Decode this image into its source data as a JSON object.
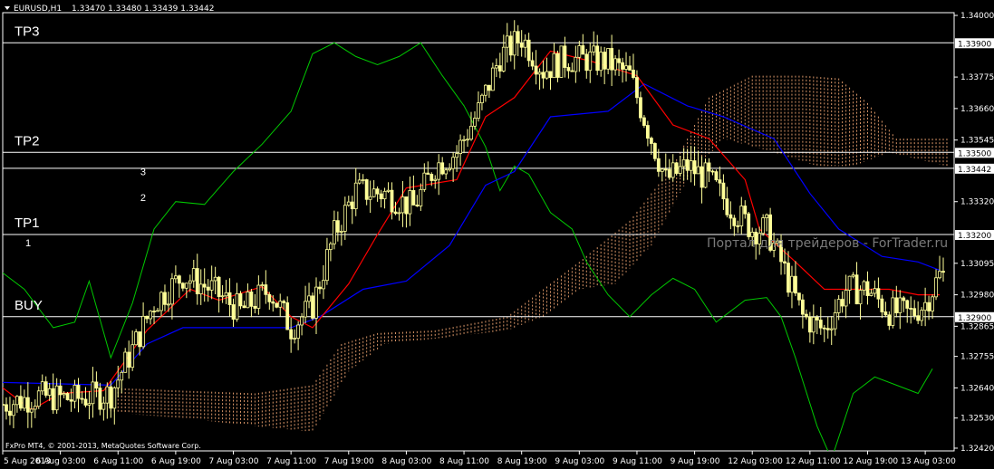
{
  "window": {
    "symbol": "EURUSD,H1",
    "quote": "1.33470 1.33480 1.33439 1.33442",
    "watermark": "Портал для трейдеров - ForTrader.ru",
    "copyright": "FxPro MT4, © 2001-2013, MetaQuotes Software Corp."
  },
  "colors": {
    "background": "#000000",
    "candle": "#ffff99",
    "tenkan": "#ff0000",
    "kijun": "#0000ff",
    "chikou": "#00c800",
    "cloud": "#ffb07a",
    "level_line": "#ffffff"
  },
  "levels": [
    {
      "label": "TP3",
      "price": 1.339,
      "tag": "1.33900"
    },
    {
      "label": "TP2",
      "price": 1.335,
      "tag": "1.33500"
    },
    {
      "label": "",
      "price": 1.33442,
      "tag": "1.33442"
    },
    {
      "label": "TP1",
      "price": 1.332,
      "tag": "1.33200"
    },
    {
      "label": "BUY",
      "price": 1.329,
      "tag": "1.32900"
    }
  ],
  "wave_marks": [
    {
      "text": "3",
      "time": 6.5,
      "price": 1.3343
    },
    {
      "text": "2",
      "time": 6.5,
      "price": 1.33335
    },
    {
      "text": "1",
      "time": 1.0,
      "price": 1.3317
    }
  ],
  "chart_data": {
    "type": "candlestick",
    "title": "EURUSD,H1",
    "ylim": [
      1.3241,
      1.3401
    ],
    "y_ticks": [
      "1.34000",
      "1.33775",
      "1.33660",
      "1.33545",
      "1.33320",
      "1.33095",
      "1.32980",
      "1.32865",
      "1.32755",
      "1.32640",
      "1.32530",
      "1.32420"
    ],
    "x_ticks": [
      {
        "label": "5 Aug 2013",
        "bar": 0
      },
      {
        "label": "6 Aug 03:00",
        "bar": 16
      },
      {
        "label": "6 Aug 11:00",
        "bar": 32
      },
      {
        "label": "6 Aug 19:00",
        "bar": 48
      },
      {
        "label": "7 Aug 03:00",
        "bar": 64
      },
      {
        "label": "7 Aug 11:00",
        "bar": 80
      },
      {
        "label": "7 Aug 19:00",
        "bar": 96
      },
      {
        "label": "8 Aug 03:00",
        "bar": 112
      },
      {
        "label": "8 Aug 11:00",
        "bar": 128
      },
      {
        "label": "8 Aug 19:00",
        "bar": 144
      },
      {
        "label": "9 Aug 03:00",
        "bar": 160
      },
      {
        "label": "9 Aug 11:00",
        "bar": 176
      },
      {
        "label": "9 Aug 19:00",
        "bar": 192
      },
      {
        "label": "12 Aug 03:00",
        "bar": 208
      },
      {
        "label": "12 Aug 11:00",
        "bar": 224
      },
      {
        "label": "12 Aug 19:00",
        "bar": 240
      },
      {
        "label": "13 Aug 03:00",
        "bar": 256
      }
    ],
    "close_path": [
      [
        0,
        1.3258
      ],
      [
        10,
        1.3261
      ],
      [
        20,
        1.326
      ],
      [
        30,
        1.3262
      ],
      [
        36,
        1.3278
      ],
      [
        42,
        1.3295
      ],
      [
        50,
        1.3305
      ],
      [
        58,
        1.33
      ],
      [
        66,
        1.3292
      ],
      [
        74,
        1.33
      ],
      [
        80,
        1.3286
      ],
      [
        86,
        1.3294
      ],
      [
        92,
        1.332
      ],
      [
        98,
        1.3336
      ],
      [
        106,
        1.3335
      ],
      [
        114,
        1.333
      ],
      [
        120,
        1.3345
      ],
      [
        126,
        1.335
      ],
      [
        132,
        1.3365
      ],
      [
        138,
        1.3385
      ],
      [
        144,
        1.3392
      ],
      [
        150,
        1.338
      ],
      [
        156,
        1.3384
      ],
      [
        162,
        1.3384
      ],
      [
        168,
        1.3383
      ],
      [
        174,
        1.3378
      ],
      [
        180,
        1.3355
      ],
      [
        184,
        1.334
      ],
      [
        190,
        1.3345
      ],
      [
        196,
        1.334
      ],
      [
        202,
        1.333
      ],
      [
        208,
        1.3322
      ],
      [
        212,
        1.3322
      ],
      [
        216,
        1.331
      ],
      [
        222,
        1.329
      ],
      [
        228,
        1.3285
      ],
      [
        234,
        1.33
      ],
      [
        240,
        1.33
      ],
      [
        246,
        1.3292
      ],
      [
        252,
        1.3291
      ],
      [
        256,
        1.3295
      ],
      [
        260,
        1.3305
      ]
    ],
    "tenkan_path": [
      [
        0,
        1.3264
      ],
      [
        8,
        1.3256
      ],
      [
        16,
        1.3262
      ],
      [
        28,
        1.3263
      ],
      [
        40,
        1.3285
      ],
      [
        52,
        1.33
      ],
      [
        60,
        1.3296
      ],
      [
        72,
        1.3301
      ],
      [
        80,
        1.329
      ],
      [
        86,
        1.3286
      ],
      [
        96,
        1.3302
      ],
      [
        104,
        1.332
      ],
      [
        112,
        1.3337
      ],
      [
        126,
        1.334
      ],
      [
        134,
        1.3363
      ],
      [
        142,
        1.337
      ],
      [
        152,
        1.3387
      ],
      [
        164,
        1.3383
      ],
      [
        176,
        1.3378
      ],
      [
        186,
        1.336
      ],
      [
        196,
        1.3355
      ],
      [
        206,
        1.334
      ],
      [
        210,
        1.3322
      ],
      [
        220,
        1.331
      ],
      [
        228,
        1.33
      ],
      [
        236,
        1.33
      ],
      [
        246,
        1.33
      ],
      [
        254,
        1.3298
      ],
      [
        260,
        1.3298
      ]
    ],
    "kijun_path": [
      [
        0,
        1.3266
      ],
      [
        30,
        1.3265
      ],
      [
        40,
        1.328
      ],
      [
        50,
        1.3286
      ],
      [
        80,
        1.3286
      ],
      [
        88,
        1.329
      ],
      [
        100,
        1.33
      ],
      [
        112,
        1.3303
      ],
      [
        124,
        1.3316
      ],
      [
        134,
        1.3338
      ],
      [
        142,
        1.3343
      ],
      [
        152,
        1.3363
      ],
      [
        168,
        1.3365
      ],
      [
        178,
        1.3375
      ],
      [
        190,
        1.3367
      ],
      [
        200,
        1.3363
      ],
      [
        214,
        1.3355
      ],
      [
        224,
        1.3335
      ],
      [
        232,
        1.3322
      ],
      [
        244,
        1.3312
      ],
      [
        254,
        1.331
      ],
      [
        260,
        1.3307
      ]
    ],
    "chikou_path": [
      [
        0,
        1.3306
      ],
      [
        6,
        1.33
      ],
      [
        14,
        1.3286
      ],
      [
        20,
        1.3288
      ],
      [
        24,
        1.3303
      ],
      [
        30,
        1.3275
      ],
      [
        36,
        1.3295
      ],
      [
        42,
        1.3322
      ],
      [
        48,
        1.3332
      ],
      [
        56,
        1.3331
      ],
      [
        64,
        1.3343
      ],
      [
        72,
        1.3353
      ],
      [
        80,
        1.3365
      ],
      [
        86,
        1.3386
      ],
      [
        92,
        1.339
      ],
      [
        98,
        1.3385
      ],
      [
        104,
        1.3382
      ],
      [
        110,
        1.3385
      ],
      [
        116,
        1.339
      ],
      [
        122,
        1.3378
      ],
      [
        128,
        1.3367
      ],
      [
        134,
        1.3352
      ],
      [
        138,
        1.3336
      ],
      [
        142,
        1.3345
      ],
      [
        146,
        1.3342
      ],
      [
        152,
        1.3328
      ],
      [
        158,
        1.3322
      ],
      [
        162,
        1.331
      ],
      [
        168,
        1.3298
      ],
      [
        174,
        1.329
      ],
      [
        180,
        1.3298
      ],
      [
        186,
        1.3304
      ],
      [
        192,
        1.33
      ],
      [
        198,
        1.3288
      ],
      [
        206,
        1.3296
      ],
      [
        212,
        1.3297
      ],
      [
        216,
        1.329
      ],
      [
        220,
        1.3275
      ],
      [
        226,
        1.325
      ],
      [
        230,
        1.3238
      ],
      [
        236,
        1.3262
      ],
      [
        242,
        1.3268
      ],
      [
        248,
        1.3265
      ],
      [
        254,
        1.3262
      ],
      [
        258,
        1.3271
      ]
    ],
    "cloud_top_path": [
      [
        30,
        1.3264
      ],
      [
        50,
        1.3263
      ],
      [
        70,
        1.3262
      ],
      [
        86,
        1.3265
      ],
      [
        94,
        1.328
      ],
      [
        104,
        1.3284
      ],
      [
        120,
        1.3285
      ],
      [
        140,
        1.329
      ],
      [
        160,
        1.331
      ],
      [
        174,
        1.3325
      ],
      [
        186,
        1.3345
      ],
      [
        196,
        1.337
      ],
      [
        208,
        1.3378
      ],
      [
        222,
        1.3378
      ],
      [
        232,
        1.3377
      ],
      [
        240,
        1.3368
      ],
      [
        248,
        1.3355
      ],
      [
        262,
        1.3355
      ]
    ],
    "cloud_bottom_path": [
      [
        30,
        1.3255
      ],
      [
        50,
        1.3253
      ],
      [
        70,
        1.325
      ],
      [
        86,
        1.3248
      ],
      [
        96,
        1.327
      ],
      [
        106,
        1.328
      ],
      [
        120,
        1.3282
      ],
      [
        140,
        1.3285
      ],
      [
        150,
        1.329
      ],
      [
        160,
        1.33
      ],
      [
        170,
        1.3302
      ],
      [
        180,
        1.3316
      ],
      [
        190,
        1.334
      ],
      [
        200,
        1.3355
      ],
      [
        214,
        1.335
      ],
      [
        226,
        1.3345
      ],
      [
        236,
        1.3345
      ],
      [
        246,
        1.335
      ],
      [
        262,
        1.3345
      ]
    ]
  }
}
